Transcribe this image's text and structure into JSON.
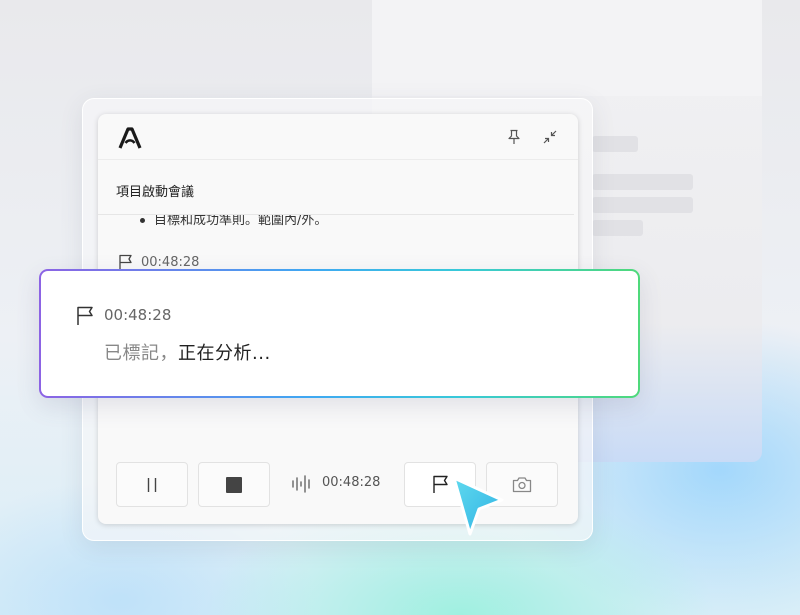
{
  "window": {
    "title": "項目啟動會議"
  },
  "header": {
    "logo_icon": "app-logo-icon",
    "pin_icon": "pin-icon",
    "collapse_icon": "collapse-icon"
  },
  "transcript": {
    "bullet_text": "目標和成功準則。範圍內/外。",
    "flag_time": "00:48:28"
  },
  "toast": {
    "time": "00:48:28",
    "message_gray": "已標記，",
    "message_dark": "正在分析..."
  },
  "controls": {
    "pause_icon": "pause-icon",
    "stop_icon": "stop-icon",
    "waveform_icon": "waveform-icon",
    "recording_time": "00:48:28",
    "flag_icon": "flag-icon",
    "camera_icon": "camera-icon"
  },
  "colors": {
    "gradient_start": "#8c63e4",
    "gradient_mid": "#3fa8f2",
    "gradient_end": "#4fd97a",
    "cursor": "#38c6ec"
  }
}
